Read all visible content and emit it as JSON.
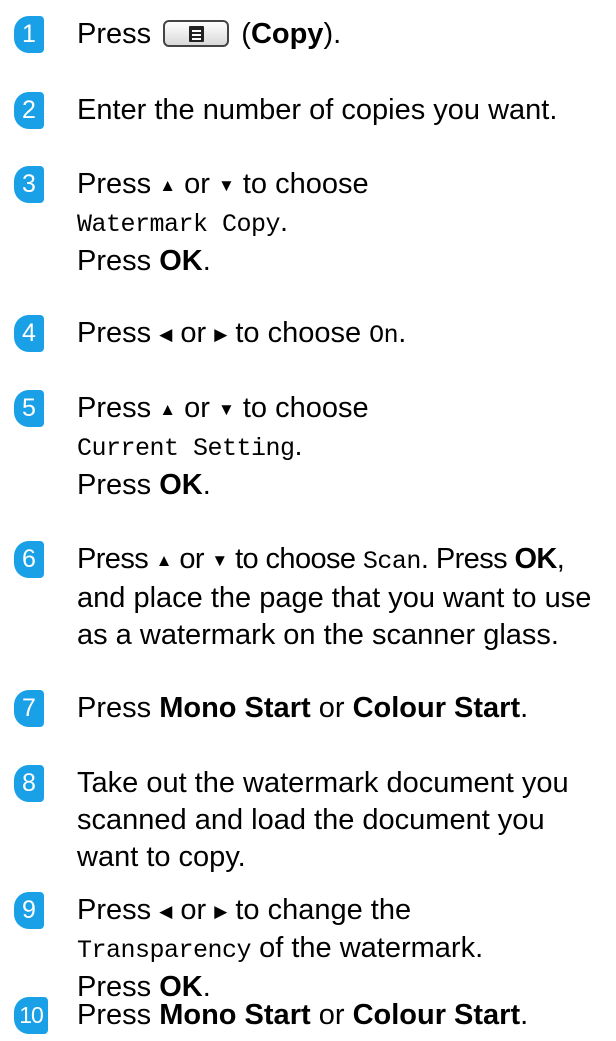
{
  "accent_color": "#1aa0e6",
  "icons": {
    "copy_key": "copy-key-icon"
  },
  "steps": [
    {
      "num": "1",
      "press": "Press",
      "open_paren": "(",
      "copy": "Copy",
      "close": ")."
    },
    {
      "num": "2",
      "text": "Enter the number of copies you want."
    },
    {
      "num": "3",
      "press": "Press",
      "up": "▲",
      "or": "or",
      "down": "▼",
      "to_choose": "to choose",
      "option": "Watermark Copy",
      "period": ".",
      "press2": "Press",
      "ok": "OK",
      "period2": "."
    },
    {
      "num": "4",
      "press": "Press",
      "left": "◀",
      "or": "or",
      "right": "▶",
      "to_choose": "to choose",
      "option": "On",
      "period": "."
    },
    {
      "num": "5",
      "press": "Press",
      "up": "▲",
      "or": "or",
      "down": "▼",
      "to_choose": "to choose",
      "option": "Current Setting",
      "period": ".",
      "press2": "Press",
      "ok": "OK",
      "period2": "."
    },
    {
      "num": "6",
      "press": "Press",
      "up": "▲",
      "or": "or",
      "down": "▼",
      "to_choose": "to choose",
      "option": "Scan",
      "period": ".",
      "press2": "Press",
      "ok": "OK",
      "comma": ",",
      "line2": "and place the page that you want to use",
      "line3": "as a watermark on the scanner glass."
    },
    {
      "num": "7",
      "press": "Press",
      "mono": "Mono Start",
      "or": "or",
      "colour": "Colour Start",
      "period": "."
    },
    {
      "num": "8",
      "line1": "Take out the watermark document you",
      "line2": "scanned and load the document you",
      "line3": "want to copy."
    },
    {
      "num": "9",
      "press": "Press",
      "left": "◀",
      "or": "or",
      "right": "▶",
      "to_change": "to change the",
      "option": "Transparency",
      "of_wm": "of the watermark.",
      "press2": "Press",
      "ok": "OK",
      "period2": "."
    },
    {
      "num": "10",
      "press": "Press",
      "mono": "Mono Start",
      "or": "or",
      "colour": "Colour Start",
      "period": "."
    }
  ]
}
